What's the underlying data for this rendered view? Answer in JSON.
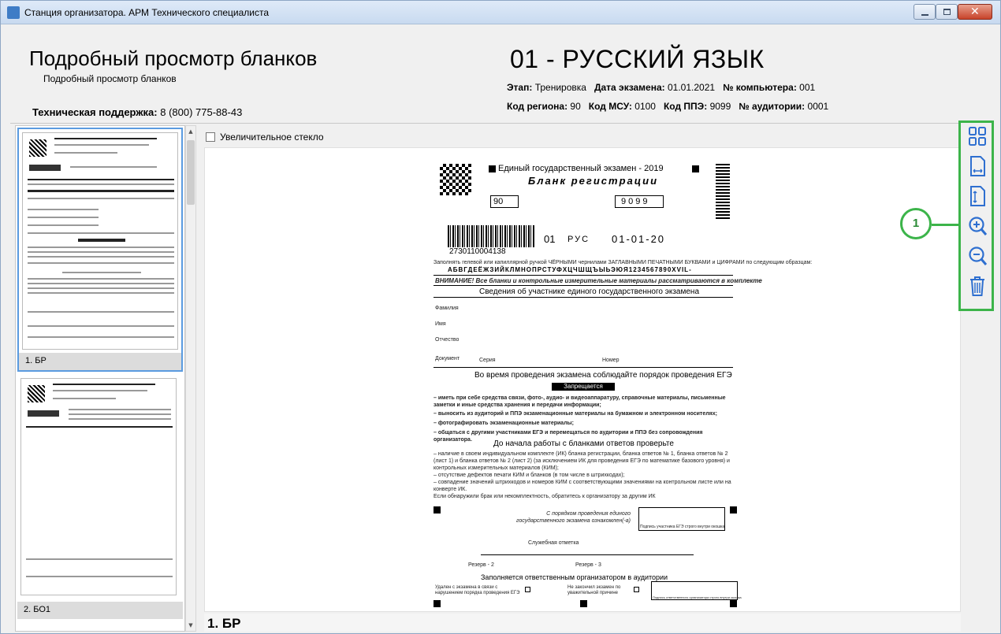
{
  "window": {
    "title": "Станция организатора. АРМ Технического специалиста"
  },
  "header": {
    "title": "Подробный просмотр бланков",
    "subtitle": "Подробный просмотр бланков",
    "support_label": "Техническая поддержка:",
    "support_phone": "8 (800) 775-88-43",
    "subject": "01 - РУССКИЙ ЯЗЫК",
    "stage_label": "Этап:",
    "stage_value": "Тренировка",
    "date_label": "Дата экзамена:",
    "date_value": "01.01.2021",
    "pc_label": "№ компьютера:",
    "pc_value": "001",
    "region_label": "Код региона:",
    "region_value": "90",
    "msu_label": "Код МСУ:",
    "msu_value": "0100",
    "ppe_label": "Код ППЭ:",
    "ppe_value": "9099",
    "room_label": "№ аудитории:",
    "room_value": "0001"
  },
  "thumbnails": [
    {
      "caption": "1. БР",
      "selected": true
    },
    {
      "caption": "2. БО1",
      "selected": false
    }
  ],
  "viewer": {
    "magnifier_label": "Увеличительное стекло",
    "magnifier_checked": false,
    "doc_caption": "1. БР"
  },
  "form": {
    "exam_title": "Единый государственный экзамен - 2019",
    "blank_title": "Бланк регистрации",
    "region_code": "90",
    "ppe_code": "9099",
    "barcode_number": "2730110004138",
    "subject_code": "01",
    "subject_short": "РУС",
    "exam_date": "01-01-20",
    "fill_hint": "Заполнять гелевой или капиллярной ручкой ЧЁРНЫМИ чернилами ЗАГЛАВНЫМИ ПЕЧАТНЫМИ БУКВАМИ и ЦИФРАМИ по следующим образцам:",
    "alphabet": "АБВГДЕЁЖЗИЙКЛМНОПРСТУФХЦЧШЩЪЫЬЭЮЯ1234567890XVIL-",
    "attention": "ВНИМАНИЕ! Все бланки и контрольные измерительные материалы рассматриваются в комплекте",
    "section_participant": "Сведения об участнике единого государственного экзамена",
    "surname": "Фамилия",
    "name": "Имя",
    "patronymic": "Отчество",
    "document": "Документ",
    "series": "Серия",
    "number": "Номер",
    "rules_heading": "Во время проведения экзамена соблюдайте порядок проведения ЕГЭ",
    "forbidden": "Запрещается",
    "rules": [
      "– иметь при себе средства связи, фото-, аудио- и видеоаппаратуру, справочные материалы, письменные заметки и иные средства хранения и передачи информации;",
      "– выносить из аудиторий и ППЭ экзаменационные материалы на бумажном и электронном носителях;",
      "– фотографировать экзаменационные материалы;",
      "– общаться с другими участниками ЕГЭ и перемещаться по аудитории и ППЭ без сопровождения организатора."
    ],
    "before_heading": "До начала работы с бланками ответов проверьте",
    "checks": "– наличие в своем индивидуальном комплекте (ИК) бланка регистрации, бланка ответов № 1, бланка ответов № 2 (лист 1) и бланка ответов № 2 (лист 2) (за исключением ИК для проведения ЕГЭ по математике базового уровня) и контрольных измерительных материалов (КИМ);\n– отсутствие дефектов печати КИМ и бланков (в том числе в штрихкодах);\n– совпадение значений штрихкодов и номеров КИМ с соответствующими значениями на контрольном листе или на конверте ИК.\nЕсли обнаружили брак или некомплектность, обратитесь к организатору за другим ИК",
    "familiarized": "С порядком проведения единого государственного экзамена ознакомлен(-а)",
    "signature_caption": "Подпись участника ЕГЭ строго внутри окошка",
    "service_mark": "Служебная отметка",
    "reserve2": "Резерв - 2",
    "reserve3": "Резерв - 3",
    "organizer_section": "Заполняется ответственным организатором в аудитории",
    "removed": "Удален с экзамена в связи с нарушением порядка проведения ЕГЭ",
    "not_finished": "Не закончил экзамен по уважительной причине",
    "organizer_sign": "Подпись ответственного организатора строго внутри окошка"
  },
  "toolbar": {
    "tools": [
      "grid-view-icon",
      "fit-width-icon",
      "fit-height-icon",
      "zoom-in-icon",
      "zoom-out-icon",
      "delete-icon"
    ],
    "callout": "1"
  }
}
